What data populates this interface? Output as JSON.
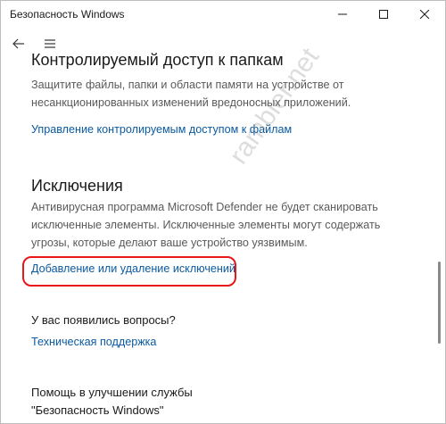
{
  "window": {
    "title": "Безопасность Windows"
  },
  "controlled_access": {
    "heading": "Контролируемый доступ к папкам",
    "desc_line1": "Защитите файлы, папки и области памяти на устройстве от",
    "desc_line2": "несанкционированных изменений вредоносных приложений.",
    "link": "Управление контролируемым доступом к файлам"
  },
  "exclusions": {
    "heading": "Исключения",
    "desc_line1": "Антивирусная программа Microsoft Defender не будет сканировать",
    "desc_line2": "исключенные элементы. Исключенные элементы могут содержать",
    "desc_line3": "угрозы, которые делают ваше устройство уязвимым.",
    "link": "Добавление или удаление исключений"
  },
  "questions": {
    "heading": "У вас появились вопросы?",
    "link": "Техническая поддержка"
  },
  "improve": {
    "line1": "Помощь в улучшении службы",
    "line2": "\"Безопасность Windows\""
  },
  "watermark": "rambler.net",
  "colors": {
    "link": "#0b5aa2",
    "highlight": "#e8151b"
  }
}
